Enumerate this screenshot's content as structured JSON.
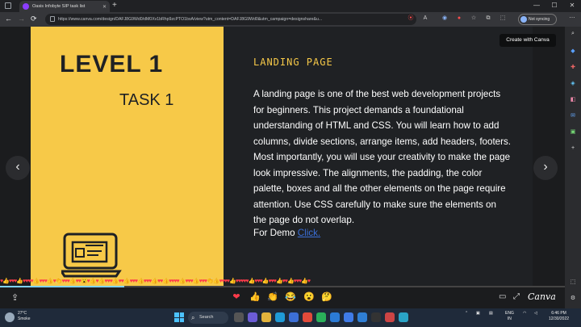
{
  "browser": {
    "tab_title": "Oasis Infobyte SIP task list",
    "new_tab": "+",
    "url": "https://www.canva.com/design/DAFJ8G9Wd0/dM0Xv1bRhp9zcPTO1bxA/view?utm_content=DAFJ8G9Wd0&utm_campaign=designshare&u...",
    "sync_label": "Not syncing",
    "back": "←",
    "forward": "→",
    "refresh": "⟳",
    "window_min": "—",
    "window_max": "☐",
    "window_close": "✕"
  },
  "slide": {
    "level": "LEVEL 1",
    "task": "TASK 1",
    "heading": "LANDING PAGE",
    "body": "A landing page is one of the best web development projects for beginners. This project demands a foundational understanding of HTML and CSS. You will learn how to add columns, divide sections, arrange items, add headers, footers. Most importantly, you will use your creativity to make the page look impressive. The alignments, the padding, the color palette, boxes and all the other elements on the page require attention. Use CSS carefully to make sure the elements on the page do not overlap.",
    "demo_label": "For Demo",
    "demo_link": "Click."
  },
  "viewer": {
    "create_button": "Create with Canva",
    "prev": "‹",
    "next": "›",
    "brand": "Canva",
    "progress": 0.22,
    "reactions": [
      "❤",
      "👍",
      "👏",
      "😂",
      "😮",
      "🤔"
    ]
  },
  "taskbar": {
    "temperature": "27°C",
    "weather": "Smoke",
    "search": "Search",
    "lang": "ENG",
    "region": "IN",
    "time": "6:46 PM",
    "date": "12/30/2022"
  },
  "colors": {
    "accent_yellow": "#f7c948",
    "slide_bg": "#1f2124",
    "link_blue": "#3b6fd8"
  }
}
